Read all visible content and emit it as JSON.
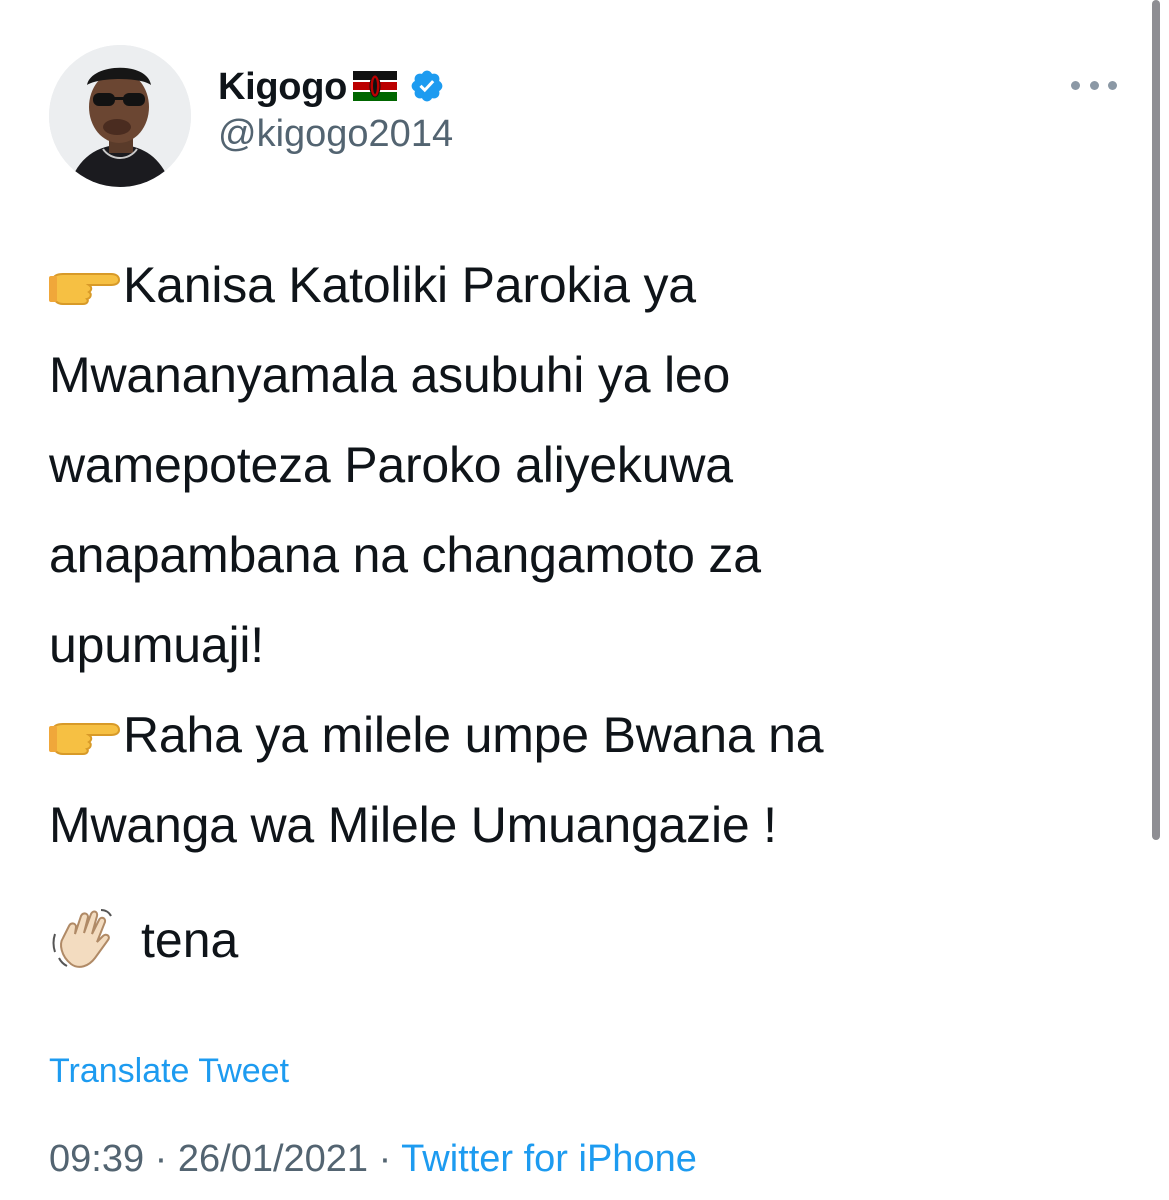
{
  "author": {
    "display_name": "Kigogo",
    "handle": "@kigogo2014",
    "verified": true,
    "flag": "kenya-flag-emoji"
  },
  "tweet": {
    "lines_para1": [
      "Kanisa Katoliki Parokia ya",
      "Mwananyamala asubuhi ya leo",
      "wamepoteza Paroko aliyekuwa",
      "anapambana na changamoto za",
      "upumuaji!"
    ],
    "lines_para2": [
      "Raha ya milele umpe Bwana na",
      "Mwanga wa Milele Umuangazie !"
    ],
    "closing": "tena",
    "pointing_emoji": "backhand-index-pointing-right-emoji",
    "waving_emoji": "waving-hand-emoji"
  },
  "actions": {
    "translate_label": "Translate Tweet",
    "more_icon": "ellipsis-icon"
  },
  "meta": {
    "time": "09:39",
    "separator": "·",
    "date": "26/01/2021",
    "source": "Twitter for iPhone"
  },
  "colors": {
    "text": "#0f1419",
    "secondary": "#536471",
    "link": "#1d9bf0",
    "verified": "#1d9bf0"
  }
}
